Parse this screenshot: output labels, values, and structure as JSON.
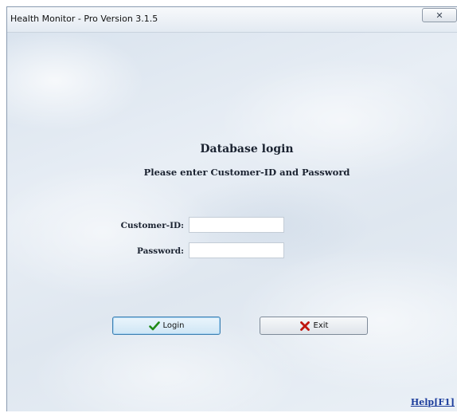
{
  "window": {
    "title": "Health Monitor - Pro Version 3.1.5",
    "close_icon": "close-icon"
  },
  "login": {
    "heading": "Database login",
    "subheading": "Please enter Customer-ID and Password",
    "customer_id_label": "Customer-ID:",
    "customer_id_value": "",
    "password_label": "Password:",
    "password_value": ""
  },
  "buttons": {
    "login_label": "Login",
    "login_icon": "check-icon",
    "exit_label": "Exit",
    "exit_icon": "x-icon"
  },
  "help": {
    "label": "Help[F1]"
  },
  "colors": {
    "check_icon": "#1f8a16",
    "x_icon": "#c0170f",
    "help_link": "#1c3d9c"
  }
}
